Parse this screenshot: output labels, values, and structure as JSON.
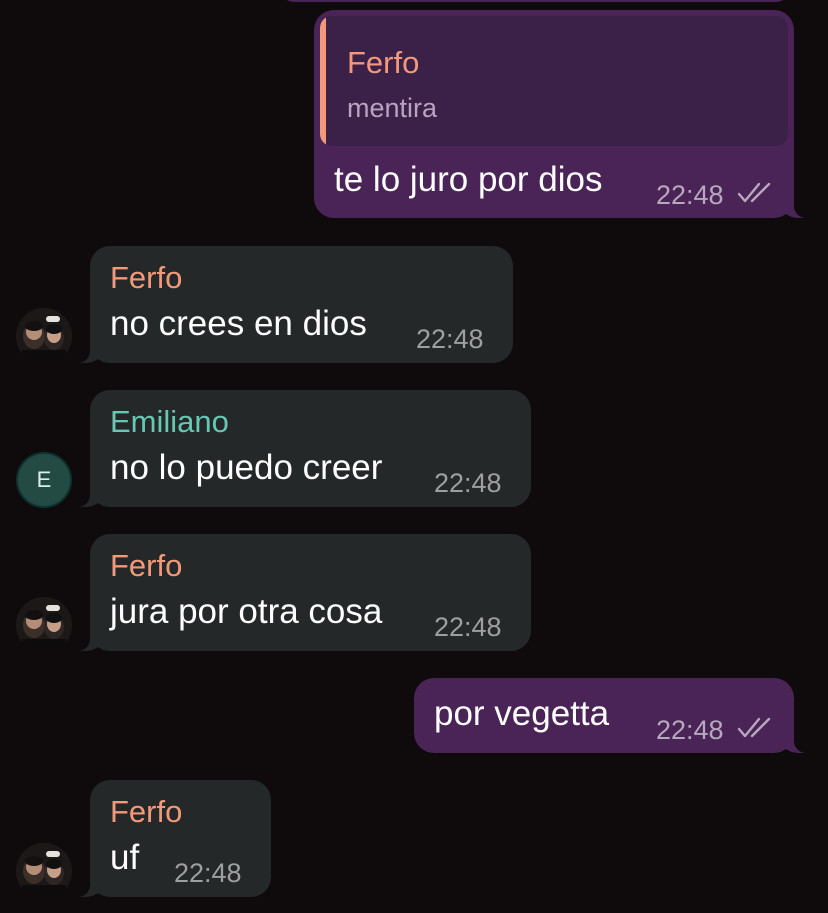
{
  "colors": {
    "background": "#0f0a0c",
    "outgoing_bubble": "#4a2457",
    "incoming_bubble": "#252828",
    "sender_ferfo": "#f2997a",
    "sender_emiliano": "#66c7b2"
  },
  "messages": [
    {
      "direction": "outgoing",
      "reply": {
        "sender": "Ferfo",
        "text": "mentira"
      },
      "text": "te lo juro por dios",
      "time": "22:48",
      "status_icon": "double-check-icon"
    },
    {
      "direction": "incoming",
      "sender": "Ferfo",
      "text": "no crees en dios",
      "time": "22:48",
      "avatar": "profile-photo"
    },
    {
      "direction": "incoming",
      "sender": "Emiliano",
      "text": "no lo puedo creer",
      "time": "22:48",
      "avatar_letter": "E"
    },
    {
      "direction": "incoming",
      "sender": "Ferfo",
      "text": "jura por otra cosa",
      "time": "22:48",
      "avatar": "profile-photo"
    },
    {
      "direction": "outgoing",
      "text": "por vegetta",
      "time": "22:48",
      "status_icon": "double-check-icon"
    },
    {
      "direction": "incoming",
      "sender": "Ferfo",
      "text": "uf",
      "time": "22:48",
      "avatar": "profile-photo"
    }
  ]
}
